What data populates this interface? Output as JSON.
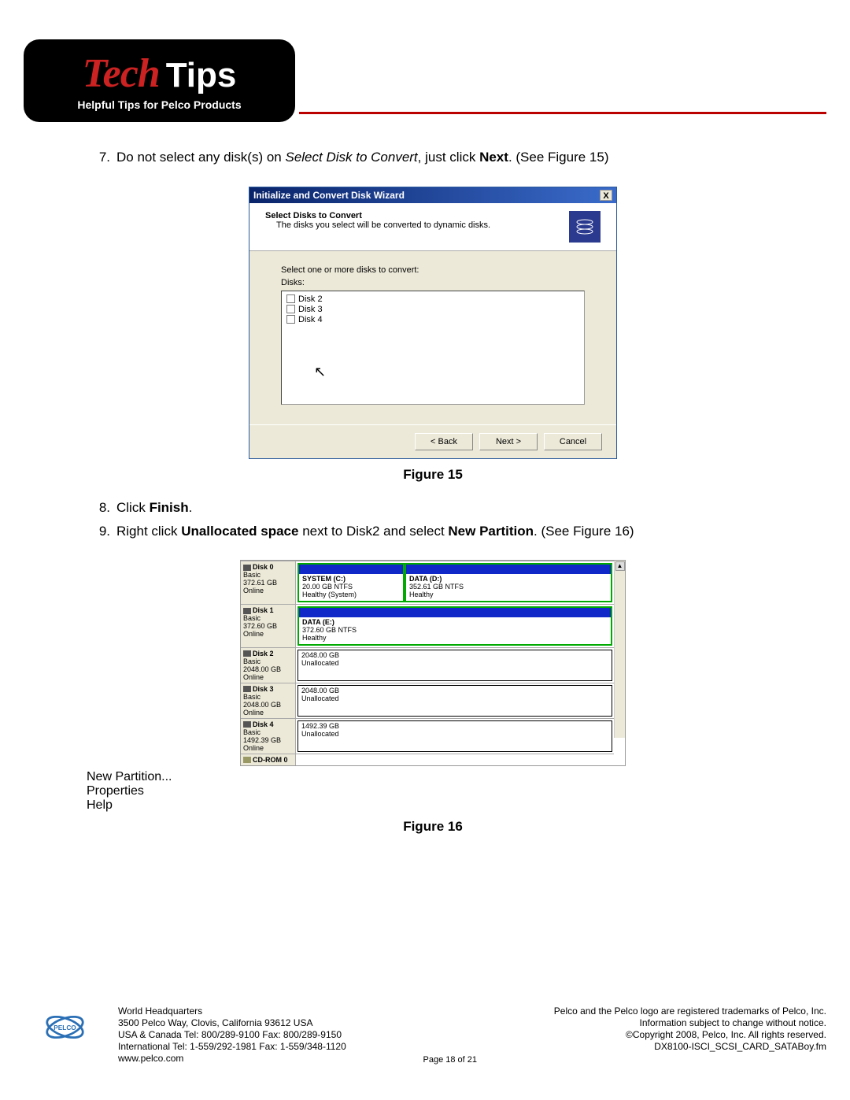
{
  "header": {
    "tech": "Tech",
    "tips": "Tips",
    "subtitle": "Helpful Tips for Pelco Products"
  },
  "steps": {
    "s7_num": "7.",
    "s7_a": "Do not select any disk(s) on ",
    "s7_b": "Select Disk to Convert",
    "s7_c": ", just click ",
    "s7_d": "Next",
    "s7_e": ". (See Figure 15)",
    "s8_num": "8.",
    "s8_a": "Click ",
    "s8_b": "Finish",
    "s8_c": ".",
    "s9_num": "9.",
    "s9_a": "Right click ",
    "s9_b": "Unallocated space",
    "s9_c": " next to Disk2 and select ",
    "s9_d": "New Partition",
    "s9_e": ". (See Figure 16)"
  },
  "dialog": {
    "title": "Initialize and Convert Disk Wizard",
    "close": "X",
    "heading": "Select Disks to Convert",
    "subheading": "The disks you select will be converted to dynamic disks.",
    "prompt": "Select one or more disks to convert:",
    "label": "Disks:",
    "items": [
      "Disk 2",
      "Disk 3",
      "Disk 4"
    ],
    "buttons": {
      "back": "< Back",
      "next": "Next >",
      "cancel": "Cancel"
    }
  },
  "fig15": "Figure 15",
  "fig16": "Figure 16",
  "diskmgr": {
    "disks": [
      {
        "name": "Disk 0",
        "type": "Basic",
        "size": "372.61 GB",
        "status": "Online",
        "parts": [
          {
            "title": "SYSTEM (C:)",
            "l2": "20.00 GB NTFS",
            "l3": "Healthy (System)",
            "style": "green",
            "w": "34%"
          },
          {
            "title": "DATA (D:)",
            "l2": "352.61 GB NTFS",
            "l3": "Healthy",
            "style": "green",
            "w": "66%"
          }
        ]
      },
      {
        "name": "Disk 1",
        "type": "Basic",
        "size": "372.60 GB",
        "status": "Online",
        "parts": [
          {
            "title": "DATA (E:)",
            "l2": "372.60 GB NTFS",
            "l3": "Healthy",
            "style": "green",
            "w": "100%"
          }
        ]
      },
      {
        "name": "Disk 2",
        "type": "Basic",
        "size": "2048.00 GB",
        "status": "Online",
        "parts": [
          {
            "title": "",
            "l2": "2048.00 GB",
            "l3": "Unallocated",
            "style": "plain",
            "w": "100%"
          }
        ]
      },
      {
        "name": "Disk 3",
        "type": "Basic",
        "size": "2048.00 GB",
        "status": "Online",
        "parts": [
          {
            "title": "",
            "l2": "2048.00 GB",
            "l3": "Unallocated",
            "style": "plain",
            "w": "100%"
          }
        ]
      },
      {
        "name": "Disk 4",
        "type": "Basic",
        "size": "1492.39 GB",
        "status": "Online",
        "parts": [
          {
            "title": "",
            "l2": "1492.39 GB",
            "l3": "Unallocated",
            "style": "plain",
            "w": "100%"
          }
        ]
      }
    ],
    "cdrom": "CD-ROM 0",
    "menu": [
      "New Partition...",
      "Properties",
      "Help"
    ],
    "scroll_up": "▲"
  },
  "footer": {
    "hq": "World Headquarters",
    "addr1": "3500 Pelco Way, Clovis, California 93612 USA",
    "addr2": "USA & Canada  Tel: 800/289-9100  Fax: 800/289-9150",
    "addr3": "International Tel: 1-559/292-1981 Fax: 1-559/348-1120",
    "url": "www.pelco.com",
    "page": "Page 18 of 21",
    "r1": "Pelco and the Pelco logo are registered trademarks of Pelco, Inc.",
    "r2": "Information subject to change without notice.",
    "r3": "©Copyright 2008, Pelco, Inc. All rights reserved.",
    "r4": "DX8100-ISCI_SCSI_CARD_SATABoy.fm"
  }
}
